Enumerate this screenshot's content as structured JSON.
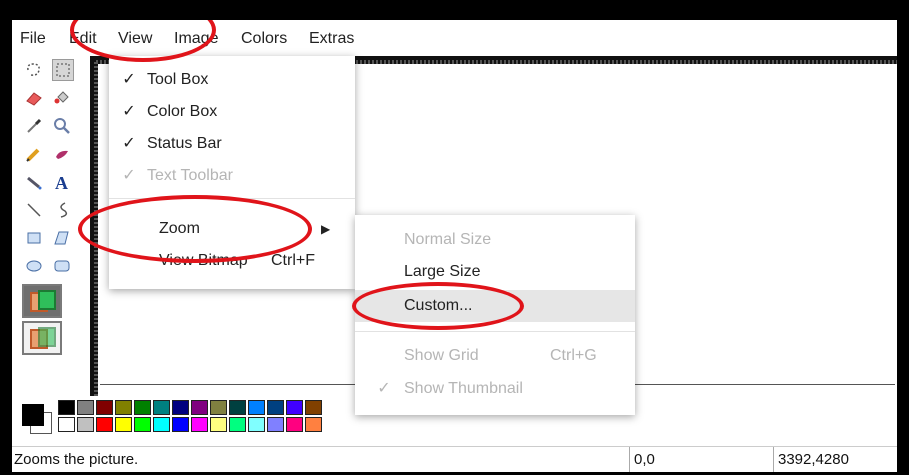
{
  "menubar": {
    "file": "File",
    "edit": "Edit",
    "view": "View",
    "image": "Image",
    "colors": "Colors",
    "extras": "Extras"
  },
  "view_menu": {
    "items": [
      {
        "label": "Tool Box",
        "checked": true,
        "disabled": false
      },
      {
        "label": "Color Box",
        "checked": true,
        "disabled": false
      },
      {
        "label": "Status Bar",
        "checked": true,
        "disabled": false
      },
      {
        "label": "Text Toolbar",
        "checked": true,
        "disabled": true
      }
    ],
    "zoom": "Zoom",
    "view_bitmap": "View Bitmap",
    "view_bitmap_shortcut": "Ctrl+F",
    "check_mark": "✓",
    "submenu_arrow": "▶"
  },
  "zoom_menu": {
    "normal_size": "Normal Size",
    "large_size": "Large Size",
    "custom": "Custom...",
    "show_grid": "Show Grid",
    "show_grid_shortcut": "Ctrl+G",
    "show_thumbnail": "Show Thumbnail"
  },
  "toolbox": {
    "tools": [
      "free-select-icon",
      "rect-select-icon",
      "eraser-icon",
      "fill-icon",
      "color-picker-icon",
      "magnifier-icon",
      "pencil-icon",
      "brush-icon",
      "airbrush-icon",
      "text-icon",
      "line-icon",
      "curve-icon",
      "rectangle-icon",
      "polygon-icon",
      "ellipse-icon",
      "rounded-rect-icon"
    ]
  },
  "palette": {
    "row1": [
      "#000000",
      "#808080",
      "#800000",
      "#808000",
      "#008000",
      "#008080",
      "#000080",
      "#800080",
      "#808040",
      "#004040",
      "#0080ff",
      "#004080",
      "#4000ff",
      "#804000"
    ],
    "row2": [
      "#ffffff",
      "#c0c0c0",
      "#ff0000",
      "#ffff00",
      "#00ff00",
      "#00ffff",
      "#0000ff",
      "#ff00ff",
      "#ffff80",
      "#00ff80",
      "#80ffff",
      "#8080ff",
      "#ff0080",
      "#ff8040"
    ]
  },
  "status": {
    "message": "Zooms the picture.",
    "position": "0,0",
    "size": "3392,4280"
  },
  "annotation_color": "#e0141a"
}
